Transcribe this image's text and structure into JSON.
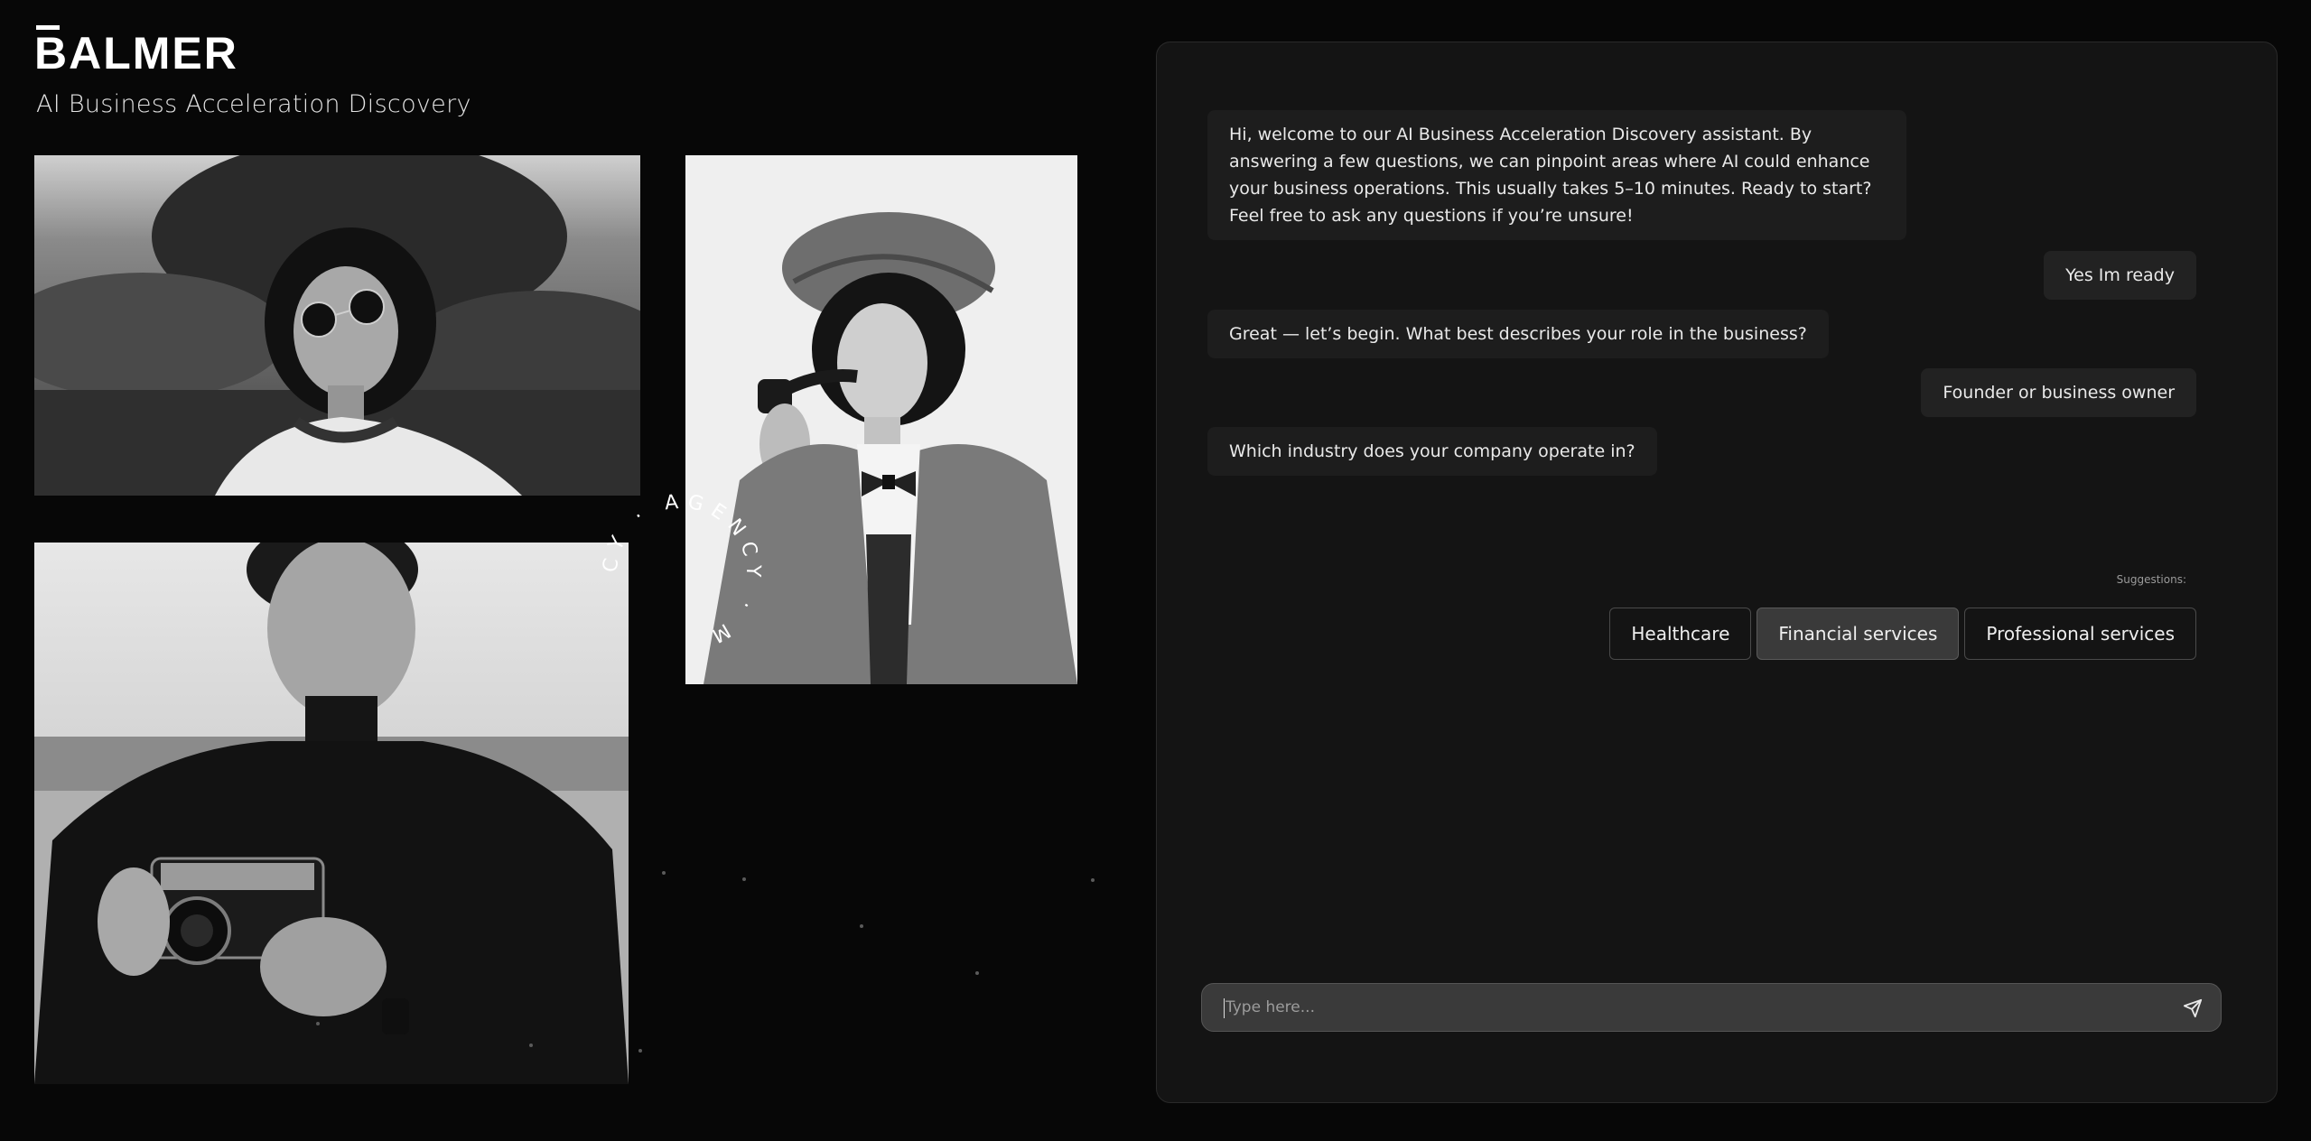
{
  "brand": {
    "name": "BALMER",
    "subtitle": "AI Business Acceleration Discovery"
  },
  "decor": {
    "ring_text": "CY · AGENCY · M"
  },
  "chat": {
    "messages": [
      {
        "role": "assistant",
        "text": "Hi, welcome to our AI Business Acceleration Discovery assistant. By answering a few questions, we can pinpoint areas where AI could enhance your business operations. This usually takes 5–10 minutes. Ready to start? Feel free to ask any questions if you’re unsure!"
      },
      {
        "role": "user",
        "text": "Yes Im ready"
      },
      {
        "role": "assistant",
        "text": "Great — let’s begin. What best describes your role in the business?"
      },
      {
        "role": "user",
        "text": "Founder or business owner"
      },
      {
        "role": "assistant",
        "text": "Which industry does your company operate in?"
      }
    ],
    "suggestions_label": "Suggestions:",
    "suggestions": [
      {
        "label": "Healthcare",
        "selected": false
      },
      {
        "label": "Financial services",
        "selected": true
      },
      {
        "label": "Professional services",
        "selected": false
      }
    ],
    "input": {
      "placeholder": "Type here...",
      "value": ""
    }
  },
  "icons": {
    "send": "send-icon"
  }
}
